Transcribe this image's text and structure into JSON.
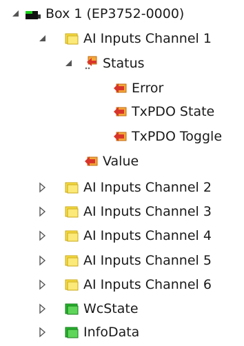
{
  "colors": {
    "folder_yellow": "#f6dc45",
    "folder_green": "#26b52e",
    "arrow_red": "#d8352a",
    "arrow_orange": "#f3a73a",
    "toggle_gray": "#555555",
    "box_green": "#1bd11b"
  },
  "tree": {
    "box": {
      "label": "Box 1 (EP3752-0000)",
      "icon": "box-module-icon",
      "expanded": true
    },
    "channel_1": {
      "label": "AI Inputs Channel 1",
      "icon": "yellow-folder-icon",
      "expanded": true,
      "status": {
        "label": "Status",
        "icon": "variable-group-icon",
        "expanded": true,
        "items": [
          {
            "label": "Error",
            "icon": "input-variable-icon"
          },
          {
            "label": "TxPDO State",
            "icon": "input-variable-icon"
          },
          {
            "label": "TxPDO Toggle",
            "icon": "input-variable-icon"
          }
        ]
      },
      "value": {
        "label": "Value",
        "icon": "input-variable-icon"
      }
    },
    "collapsed_channels": [
      {
        "label": "AI Inputs Channel 2",
        "icon": "yellow-folder-icon"
      },
      {
        "label": "AI Inputs Channel 3",
        "icon": "yellow-folder-icon"
      },
      {
        "label": "AI Inputs Channel 4",
        "icon": "yellow-folder-icon"
      },
      {
        "label": "AI Inputs Channel 5",
        "icon": "yellow-folder-icon"
      },
      {
        "label": "AI Inputs Channel 6",
        "icon": "yellow-folder-icon"
      }
    ],
    "wcstate": {
      "label": "WcState",
      "icon": "green-folder-icon"
    },
    "infodata": {
      "label": "InfoData",
      "icon": "green-folder-icon"
    }
  }
}
